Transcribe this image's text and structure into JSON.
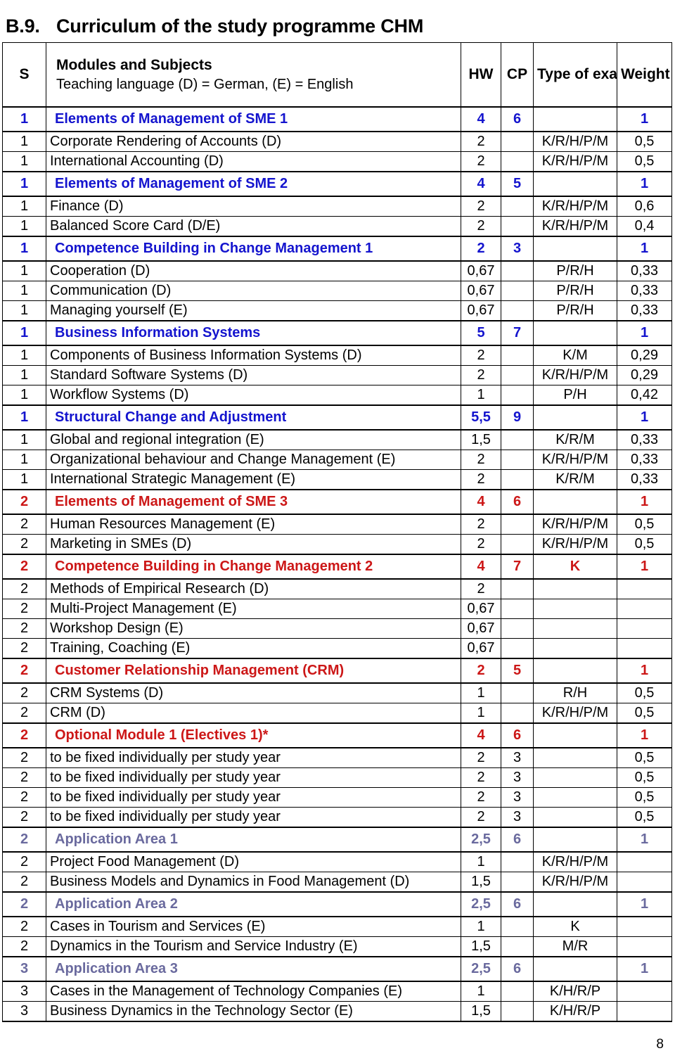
{
  "heading": {
    "number": "B.9.",
    "title": "Curriculum of the study programme CHM"
  },
  "table": {
    "columns": {
      "s": "S",
      "subjects_line1": "Modules and Subjects",
      "subjects_line2": "Teaching language (D) = German, (E) = English",
      "hw": "HW",
      "cp": "CP",
      "type": "Type of exam",
      "weight": "Weight"
    },
    "rows": [
      {
        "kind": "module",
        "tone": "blue",
        "s": "1",
        "subject": "Elements of Management of SME 1",
        "hw": "4",
        "cp": "6",
        "type": "",
        "weight": "1"
      },
      {
        "kind": "subject",
        "tone": "black",
        "s": "1",
        "subject": "Corporate Rendering of Accounts (D)",
        "hw": "2",
        "cp": "",
        "type": "K/R/H/P/M",
        "weight": "0,5"
      },
      {
        "kind": "subject",
        "tone": "black",
        "s": "1",
        "subject": "International Accounting (D)",
        "hw": "2",
        "cp": "",
        "type": "K/R/H/P/M",
        "weight": "0,5"
      },
      {
        "kind": "module",
        "tone": "blue",
        "s": "1",
        "subject": "Elements of Management of SME 2",
        "hw": "4",
        "cp": "5",
        "type": "",
        "weight": "1"
      },
      {
        "kind": "subject",
        "tone": "black",
        "s": "1",
        "subject": "Finance (D)",
        "hw": "2",
        "cp": "",
        "type": "K/R/H/P/M",
        "weight": "0,6"
      },
      {
        "kind": "subject",
        "tone": "black",
        "s": "1",
        "subject": "Balanced Score Card (D/E)",
        "hw": "2",
        "cp": "",
        "type": "K/R/H/P/M",
        "weight": "0,4"
      },
      {
        "kind": "module",
        "tone": "blue",
        "s": "1",
        "subject": "Competence Building in Change Management 1",
        "hw": "2",
        "cp": "3",
        "type": "",
        "weight": "1"
      },
      {
        "kind": "subject",
        "tone": "black",
        "s": "1",
        "subject": "Cooperation (D)",
        "hw": "0,67",
        "cp": "",
        "type": "P/R/H",
        "weight": "0,33"
      },
      {
        "kind": "subject",
        "tone": "black",
        "s": "1",
        "subject": "Communication (D)",
        "hw": "0,67",
        "cp": "",
        "type": "P/R/H",
        "weight": "0,33"
      },
      {
        "kind": "subject",
        "tone": "black",
        "s": "1",
        "subject": "Managing yourself (E)",
        "hw": "0,67",
        "cp": "",
        "type": "P/R/H",
        "weight": "0,33"
      },
      {
        "kind": "module",
        "tone": "blue",
        "s": "1",
        "subject": "Business Information Systems",
        "hw": "5",
        "cp": "7",
        "type": "",
        "weight": "1"
      },
      {
        "kind": "subject",
        "tone": "black",
        "s": "1",
        "subject": "Components of Business Information Systems (D)",
        "hw": "2",
        "cp": "",
        "type": "K/M",
        "weight": "0,29"
      },
      {
        "kind": "subject",
        "tone": "black",
        "s": "1",
        "subject": "Standard Software Systems (D)",
        "hw": "2",
        "cp": "",
        "type": "K/R/H/P/M",
        "weight": "0,29"
      },
      {
        "kind": "subject",
        "tone": "black",
        "s": "1",
        "subject": "Workflow Systems (D)",
        "hw": "1",
        "cp": "",
        "type": "P/H",
        "weight": "0,42"
      },
      {
        "kind": "module",
        "tone": "blue",
        "s": "1",
        "subject": "Structural Change and Adjustment",
        "hw": "5,5",
        "cp": "9",
        "type": "",
        "weight": "1"
      },
      {
        "kind": "subject",
        "tone": "black",
        "s": "1",
        "subject": "Global and regional integration (E)",
        "hw": "1,5",
        "cp": "",
        "type": "K/R/M",
        "weight": "0,33"
      },
      {
        "kind": "subject",
        "tone": "black",
        "s": "1",
        "subject": "Organizational behaviour and Change Management (E)",
        "hw": "2",
        "cp": "",
        "type": "K/R/H/P/M",
        "weight": "0,33"
      },
      {
        "kind": "subject",
        "tone": "black",
        "s": "1",
        "subject": "International Strategic Management (E)",
        "hw": "2",
        "cp": "",
        "type": "K/R/M",
        "weight": "0,33"
      },
      {
        "kind": "module",
        "tone": "red",
        "s": "2",
        "subject": "Elements of Management of SME 3",
        "hw": "4",
        "cp": "6",
        "type": "",
        "weight": "1"
      },
      {
        "kind": "subject",
        "tone": "black",
        "s": "2",
        "subject": "Human Resources Management (E)",
        "hw": "2",
        "cp": "",
        "type": "K/R/H/P/M",
        "weight": "0,5"
      },
      {
        "kind": "subject",
        "tone": "black",
        "s": "2",
        "subject": "Marketing in SMEs (D)",
        "hw": "2",
        "cp": "",
        "type": "K/R/H/P/M",
        "weight": "0,5"
      },
      {
        "kind": "module",
        "tone": "red",
        "s": "2",
        "subject": "Competence Building in Change Management 2",
        "hw": "4",
        "cp": "7",
        "type": "K",
        "weight": "1"
      },
      {
        "kind": "subject",
        "tone": "black",
        "s": "2",
        "subject": "Methods of Empirical Research (D)",
        "hw": "2",
        "cp": "",
        "type": "",
        "weight": ""
      },
      {
        "kind": "subject",
        "tone": "black",
        "s": "2",
        "subject": "Multi-Project Management (E)",
        "hw": "0,67",
        "cp": "",
        "type": "",
        "weight": ""
      },
      {
        "kind": "subject",
        "tone": "black",
        "s": "2",
        "subject": "Workshop Design (E)",
        "hw": "0,67",
        "cp": "",
        "type": "",
        "weight": ""
      },
      {
        "kind": "subject",
        "tone": "black",
        "s": "2",
        "subject": "Training, Coaching (E)",
        "hw": "0,67",
        "cp": "",
        "type": "",
        "weight": ""
      },
      {
        "kind": "module",
        "tone": "red",
        "s": "2",
        "subject": "Customer Relationship Management (CRM)",
        "hw": "2",
        "cp": "5",
        "type": "",
        "weight": "1"
      },
      {
        "kind": "subject",
        "tone": "black",
        "s": "2",
        "subject": "CRM Systems (D)",
        "hw": "1",
        "cp": "",
        "type": "R/H",
        "weight": "0,5"
      },
      {
        "kind": "subject",
        "tone": "black",
        "s": "2",
        "subject": "CRM (D)",
        "hw": "1",
        "cp": "",
        "type": "K/R/H/P/M",
        "weight": "0,5"
      },
      {
        "kind": "module",
        "tone": "red",
        "s": "2",
        "subject": "Optional Module 1 (Electives 1)*",
        "hw": "4",
        "cp": "6",
        "type": "",
        "weight": "1"
      },
      {
        "kind": "subject",
        "tone": "black",
        "s": "2",
        "subject": "to be fixed individually per study year",
        "hw": "2",
        "cp": "3",
        "type": "",
        "weight": "0,5"
      },
      {
        "kind": "subject",
        "tone": "black",
        "s": "2",
        "subject": "to be fixed individually per study year",
        "hw": "2",
        "cp": "3",
        "type": "",
        "weight": "0,5"
      },
      {
        "kind": "subject",
        "tone": "black",
        "s": "2",
        "subject": "to be fixed individually per study year",
        "hw": "2",
        "cp": "3",
        "type": "",
        "weight": "0,5"
      },
      {
        "kind": "subject",
        "tone": "black",
        "s": "2",
        "subject": "to be fixed individually per study year",
        "hw": "2",
        "cp": "3",
        "type": "",
        "weight": "0,5"
      },
      {
        "kind": "module",
        "tone": "purple",
        "s": "2",
        "subject": "Application Area 1",
        "hw": "2,5",
        "cp": "6",
        "type": "",
        "weight": "1"
      },
      {
        "kind": "subject",
        "tone": "black",
        "s": "2",
        "subject": "Project Food Management (D)",
        "hw": "1",
        "cp": "",
        "type": "K/R/H/P/M",
        "weight": ""
      },
      {
        "kind": "subject",
        "tone": "black",
        "s": "2",
        "subject": "Business Models and Dynamics in Food Management (D)",
        "hw": "1,5",
        "cp": "",
        "type": "K/R/H/P/M",
        "weight": ""
      },
      {
        "kind": "module",
        "tone": "purple",
        "s": "2",
        "subject": "Application Area 2",
        "hw": "2,5",
        "cp": "6",
        "type": "",
        "weight": "1"
      },
      {
        "kind": "subject",
        "tone": "black",
        "s": "2",
        "subject": "Cases in Tourism and Services (E)",
        "hw": "1",
        "cp": "",
        "type": "K",
        "weight": ""
      },
      {
        "kind": "subject",
        "tone": "black",
        "s": "2",
        "subject": "Dynamics in the Tourism and Service Industry (E)",
        "hw": "1,5",
        "cp": "",
        "type": "M/R",
        "weight": ""
      },
      {
        "kind": "module",
        "tone": "purple",
        "s": "3",
        "subject": "Application Area 3",
        "hw": "2,5",
        "cp": "6",
        "type": "",
        "weight": "1"
      },
      {
        "kind": "subject",
        "tone": "black",
        "s": "3",
        "subject": "Cases in the Management of Technology Companies (E)",
        "hw": "1",
        "cp": "",
        "type": "K/H/R/P",
        "weight": ""
      },
      {
        "kind": "subject",
        "tone": "black",
        "s": "3",
        "subject": "Business Dynamics in the Technology Sector (E)",
        "hw": "1,5",
        "cp": "",
        "type": "K/H/R/P",
        "weight": ""
      }
    ]
  },
  "footer": {
    "page_number": "8"
  },
  "colors": {
    "semester1_module": "#1414CE",
    "semester2_module": "#CC1717",
    "application_area": "#6A6A9E",
    "text": "#000000",
    "border": "#000000"
  }
}
